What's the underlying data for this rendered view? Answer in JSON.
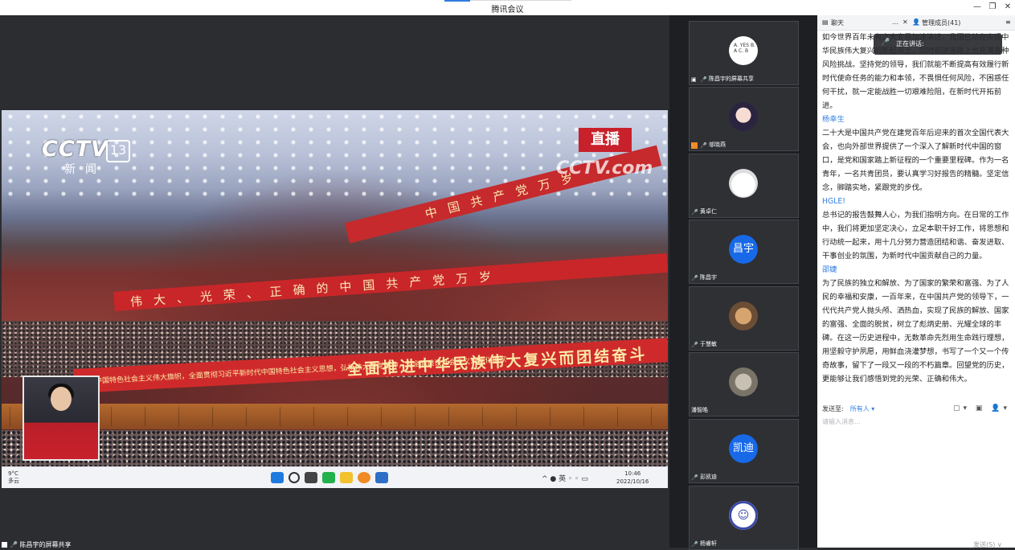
{
  "window": {
    "title": "腾讯会议"
  },
  "share": {
    "channel_logo": "CCTV",
    "channel_number": "13",
    "channel_name": "新闻",
    "live_label": "直播",
    "watermark": "CCTV.com",
    "banner_top": "伟大、光荣、正确的中国共产党万岁",
    "banner_main": "全面推进中华民族伟大复兴而团结奋斗",
    "banner_small": "高举中国特色社会主义伟大旗帜，全面贯彻习近平新时代中国特色社会主义思想，弘扬伟大建党精神，为全面建设社会主义现代化国家",
    "taskbar": {
      "weather_temp": "9°C",
      "weather_desc": "多云",
      "ime": "英",
      "clock_time": "10:46",
      "clock_date": "2022/10/16"
    }
  },
  "bottom_label": "陈昌宇的屏幕共享",
  "participants": [
    {
      "name": "陈昌宇的屏幕共享",
      "avatar_text": "A. YES B. A C. B",
      "kind": "image"
    },
    {
      "name": "邬晓燕",
      "kind": "image"
    },
    {
      "name": "黄卓仁",
      "kind": "image"
    },
    {
      "name": "陈昌宇",
      "initials": "昌宇",
      "kind": "initials"
    },
    {
      "name": "于慧敏",
      "kind": "image"
    },
    {
      "name": "潘智皓",
      "kind": "image"
    },
    {
      "name": "彭凯迪",
      "initials": "凯迪",
      "kind": "initials"
    },
    {
      "name": "杨睿轩",
      "kind": "image"
    }
  ],
  "sidebar": {
    "tab_chat": "聊天",
    "tab_members": "管理成员(41)",
    "speaking_label": "正在讲话:",
    "messages": [
      {
        "author": "",
        "text": "如今世界百年未有之大变局加速演进，我国已站在实现中华民族伟大复兴的新起点上，同时前进道路上也充满各种风险挑战。坚持党的领导，我们就能不断提高有效履行新时代使命任务的能力和本领，不畏惧任何风险，不困惑任何干扰，就一定能战胜一切艰难险阻，在新时代开拓前进。"
      },
      {
        "author": "杨幸生",
        "text": "二十大是中国共产党在建党百年后迎来的首次全国代表大会，也向外部世界提供了一个深入了解新时代中国的窗口，是党和国家踏上新征程的一个重要里程碑。作为一名青年，一名共青团员，要认真学习好报告的精髓。坚定信念，脚踏实地，紧跟党的步伐。"
      },
      {
        "author": "HGLE!",
        "text": "总书记的报告鼓舞人心，为我们指明方向。在日常的工作中，我们将更加坚定决心，立足本职干好工作，将思想和行动统一起来，用十几分努力营造团结和谐、奋发进取、干事创业的氛围，为新时代中国贡献自己的力量。"
      },
      {
        "author": "邵婕",
        "text": "为了民族的独立和解放、为了国家的繁荣和富强、为了人民的幸福和安康，一百年来，在中国共产党的领导下，一代代共产党人抛头颅、洒热血，实现了民族的解放、国家的富强、全面的脱贫，树立了彪炳史册、光耀全球的丰碑。在这一历史进程中，无数革命先烈用生命践行理想，用坚毅守护夙愿，用鲜血浇灌梦想，书写了一个又一个传奇故事，留下了一段又一段的不朽篇章。回望党的历史，更能够让我们感悟到党的光荣、正确和伟大。"
      }
    ],
    "send_to_label": "发送至:",
    "send_to_target": "所有人",
    "input_placeholder": "请输入消息...",
    "send_button": "发送(S)"
  }
}
